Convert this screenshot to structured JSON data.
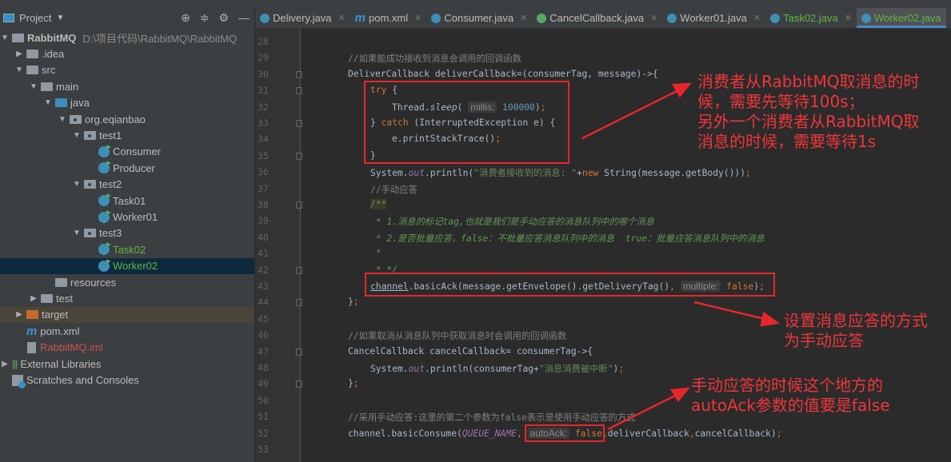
{
  "sidebar": {
    "title": "Project",
    "tree": [
      {
        "label": "RabbitMQ",
        "path": "D:\\项目代码\\RabbitMQ\\RabbitMQ",
        "depth": 0,
        "arrow": "down",
        "icon": "module",
        "bold": true
      },
      {
        "label": ".idea",
        "depth": 1,
        "arrow": "right",
        "icon": "folder"
      },
      {
        "label": "src",
        "depth": 1,
        "arrow": "down",
        "icon": "folder"
      },
      {
        "label": "main",
        "depth": 2,
        "arrow": "down",
        "icon": "folder"
      },
      {
        "label": "java",
        "depth": 3,
        "arrow": "down",
        "icon": "folder-blue"
      },
      {
        "label": "org.eqianbao",
        "depth": 4,
        "arrow": "down",
        "icon": "package"
      },
      {
        "label": "test1",
        "depth": 5,
        "arrow": "down",
        "icon": "package"
      },
      {
        "label": "Consumer",
        "depth": 6,
        "icon": "class"
      },
      {
        "label": "Producer",
        "depth": 6,
        "icon": "class"
      },
      {
        "label": "test2",
        "depth": 5,
        "arrow": "down",
        "icon": "package"
      },
      {
        "label": "Task01",
        "depth": 6,
        "icon": "class"
      },
      {
        "label": "Worker01",
        "depth": 6,
        "icon": "class"
      },
      {
        "label": "test3",
        "depth": 5,
        "arrow": "down",
        "icon": "package"
      },
      {
        "label": "Task02",
        "depth": 6,
        "icon": "class",
        "color": "#62b543"
      },
      {
        "label": "Worker02",
        "depth": 6,
        "icon": "class",
        "color": "#62b543",
        "selected": true
      },
      {
        "label": "resources",
        "depth": 3,
        "icon": "folder"
      },
      {
        "label": "test",
        "depth": 2,
        "arrow": "right",
        "icon": "folder"
      },
      {
        "label": "target",
        "depth": 1,
        "arrow": "right",
        "icon": "folder-orange",
        "excluded": true
      },
      {
        "label": "pom.xml",
        "depth": 1,
        "icon": "maven"
      },
      {
        "label": "RabbitMQ.iml",
        "depth": 1,
        "icon": "iml",
        "color": "#c75450"
      },
      {
        "label": "External Libraries",
        "depth": 0,
        "arrow": "right",
        "icon": "libraries"
      },
      {
        "label": "Scratches and Consoles",
        "depth": 0,
        "icon": "scratches"
      }
    ]
  },
  "tabs": [
    {
      "label": "Delivery.java",
      "icon": "class"
    },
    {
      "label": "pom.xml",
      "icon": "maven"
    },
    {
      "label": "Consumer.java",
      "icon": "class"
    },
    {
      "label": "CancelCallback.java",
      "icon": "interface"
    },
    {
      "label": "Worker01.java",
      "icon": "class"
    },
    {
      "label": "Task02.java",
      "icon": "class",
      "color": "#62b543"
    },
    {
      "label": "Worker02.java",
      "icon": "class",
      "color": "#62b543",
      "active": true
    }
  ],
  "editor": {
    "lines": [
      {
        "n": 28,
        "indent": 0,
        "segs": []
      },
      {
        "n": 29,
        "indent": 1,
        "segs": [
          [
            "cm",
            "//如果能成功接收到消息会调用的回调函数"
          ]
        ]
      },
      {
        "n": 30,
        "indent": 1,
        "fold": true,
        "segs": [
          [
            "",
            "DeliverCallback deliverCallback=(consumerTag, message)->{"
          ]
        ]
      },
      {
        "n": 31,
        "indent": 2,
        "fold": true,
        "segs": [
          [
            "kw",
            "try"
          ],
          [
            "",
            " {"
          ]
        ]
      },
      {
        "n": 32,
        "indent": 3,
        "segs": [
          [
            "",
            "Thread."
          ],
          [
            "it",
            "sleep"
          ],
          [
            "",
            "( "
          ],
          [
            "hint",
            "millis:"
          ],
          [
            "num",
            " 100000"
          ],
          [
            "",
            ")"
          ],
          [
            "kw",
            ";"
          ]
        ]
      },
      {
        "n": 33,
        "indent": 2,
        "fold": true,
        "segs": [
          [
            "",
            "} "
          ],
          [
            "kw",
            "catch"
          ],
          [
            "",
            " (InterruptedException e) {"
          ]
        ]
      },
      {
        "n": 34,
        "indent": 3,
        "segs": [
          [
            "",
            "e.printStackTrace()"
          ],
          [
            "kw",
            ";"
          ]
        ]
      },
      {
        "n": 35,
        "indent": 2,
        "fold": true,
        "segs": [
          [
            "",
            "}"
          ]
        ]
      },
      {
        "n": 36,
        "indent": 2,
        "segs": [
          [
            "",
            "System."
          ],
          [
            "st",
            "out"
          ],
          [
            "",
            ".println("
          ],
          [
            "str",
            "\"消费者接收到的消息: \""
          ],
          [
            "",
            "+"
          ],
          [
            "kw",
            "new "
          ],
          [
            "",
            "String(message.getBody()))"
          ],
          [
            "kw",
            ";"
          ]
        ]
      },
      {
        "n": 37,
        "indent": 2,
        "segs": [
          [
            "cm",
            "//手动应答"
          ]
        ]
      },
      {
        "n": 38,
        "indent": 2,
        "fold": true,
        "segs": [
          [
            "doc hl",
            "/**"
          ]
        ]
      },
      {
        "n": 39,
        "indent": 2,
        "segs": [
          [
            "doc",
            " * 1.消息的标记tag,也就是我们是手动应答的消息队列中的哪个消息"
          ]
        ]
      },
      {
        "n": 40,
        "indent": 2,
        "segs": [
          [
            "doc",
            " * 2.是否批量应答，false：不批量应答消息队列中的消息  true：批量应答消息队列中的消息"
          ]
        ]
      },
      {
        "n": 41,
        "indent": 2,
        "segs": [
          [
            "doc",
            " *"
          ]
        ]
      },
      {
        "n": 42,
        "indent": 2,
        "fold": true,
        "segs": [
          [
            "doc",
            " * */"
          ]
        ]
      },
      {
        "n": 43,
        "indent": 2,
        "segs": [
          [
            "ul",
            "channel"
          ],
          [
            "",
            ".basicAck(message.getEnvelope().getDeliveryTag()"
          ],
          [
            "kw",
            ", "
          ],
          [
            "hint",
            "multiple:"
          ],
          [
            "kw",
            " false"
          ],
          [
            "",
            ")"
          ],
          [
            "kw",
            ";"
          ]
        ]
      },
      {
        "n": 44,
        "indent": 1,
        "fold": true,
        "segs": [
          [
            "",
            "}"
          ],
          [
            "kw",
            ";"
          ]
        ]
      },
      {
        "n": 45,
        "indent": 0,
        "segs": []
      },
      {
        "n": 46,
        "indent": 1,
        "segs": [
          [
            "cm",
            "//如果取消从消息队列中获取消息时会调用的回调函数"
          ]
        ]
      },
      {
        "n": 47,
        "indent": 1,
        "fold": true,
        "segs": [
          [
            "",
            "CancelCallback cancelCallback= consumerTag->{"
          ]
        ]
      },
      {
        "n": 48,
        "indent": 2,
        "segs": [
          [
            "",
            "System."
          ],
          [
            "st",
            "out"
          ],
          [
            "",
            ".println(consumerTag+"
          ],
          [
            "str",
            "\"消息消费被中断\""
          ],
          [
            "",
            ")"
          ],
          [
            "kw",
            ";"
          ]
        ]
      },
      {
        "n": 49,
        "indent": 1,
        "fold": true,
        "segs": [
          [
            "",
            "}"
          ],
          [
            "kw",
            ";"
          ]
        ]
      },
      {
        "n": 50,
        "indent": 0,
        "segs": []
      },
      {
        "n": 51,
        "indent": 1,
        "segs": [
          [
            "cm",
            "//采用手动应答:这里的第二个参数为false表示是使用手动应答的方式"
          ]
        ]
      },
      {
        "n": 52,
        "indent": 1,
        "segs": [
          [
            "",
            "channel.basicConsume("
          ],
          [
            "st",
            "QUEUE_NAME"
          ],
          [
            "kw",
            ", "
          ],
          [
            "hint",
            "autoAck:"
          ],
          [
            "kw",
            " false"
          ],
          [
            "kw",
            ","
          ],
          [
            "",
            "deliverCallback"
          ],
          [
            "kw",
            ","
          ],
          [
            "",
            "cancelCallback)"
          ],
          [
            "kw",
            ";"
          ]
        ]
      },
      {
        "n": 53,
        "indent": 0,
        "segs": []
      }
    ]
  },
  "annotations": {
    "note1": [
      "消费者从RabbitMQ取消息的时",
      "候，需要先等待100s；",
      "另外一个消费者从RabbitMQ取",
      "消息的时候，需要等待1s"
    ],
    "note2": [
      "设置消息应答的方式",
      "为手动应答"
    ],
    "note3": [
      "手动应答的时候这个地方的",
      "autoAck参数的值要是false"
    ],
    "color": "#e8262a"
  }
}
